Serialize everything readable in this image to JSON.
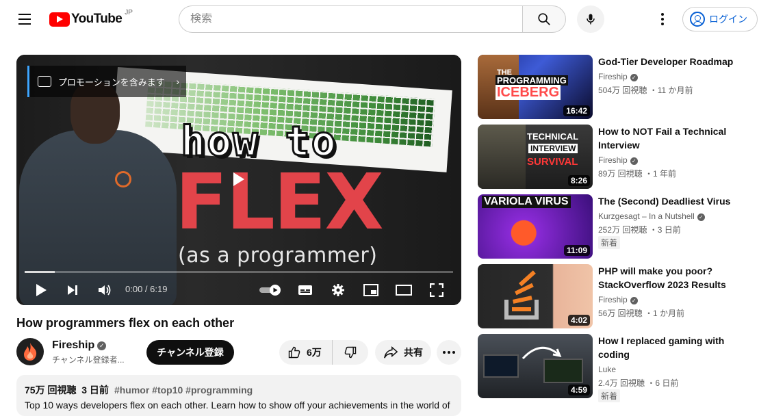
{
  "header": {
    "logo_text": "YouTube",
    "country": "JP",
    "search_placeholder": "検索",
    "login_label": "ログイン"
  },
  "player": {
    "promo_label": "プロモーションを含みます",
    "thumb_line1": "how to",
    "thumb_line2": "FLEX",
    "thumb_line3": "(as a programmer)",
    "time": "0:00 / 6:19",
    "progress": 0.07
  },
  "video": {
    "title": "How programmers flex on each other",
    "channel": "Fireship",
    "subs": "チャンネル登録者...",
    "subscribe_label": "チャンネル登録",
    "likes": "6万",
    "share_label": "共有",
    "views": "75万 回視聴",
    "date": "3 日前",
    "tags": "#humor #top10 #programming",
    "desc": "Top 10 ways developers flex on each other. Learn how to show off your achievements in the world of"
  },
  "recs": [
    {
      "title": "God-Tier Developer Roadmap",
      "channel": "Fireship",
      "verified": true,
      "meta": "504万 回視聴 ・11 か月前",
      "duration": "16:42",
      "badge": "",
      "thumb_text": "THE PROGRAMMING ICEBERG"
    },
    {
      "title": "How to NOT Fail a Technical Interview",
      "channel": "Fireship",
      "verified": true,
      "meta": "89万 回視聴 ・1 年前",
      "duration": "8:26",
      "badge": "",
      "thumb_text": "TECHNICAL INTERVIEW SURVIVAL"
    },
    {
      "title": "The (Second) Deadliest Virus",
      "channel": "Kurzgesagt – In a Nutshell",
      "verified": true,
      "meta": "252万 回視聴 ・3 日前",
      "duration": "11:09",
      "badge": "新着",
      "thumb_text": "VARIOLA VIRUS"
    },
    {
      "title": "PHP will make you poor? StackOverflow 2023 Results",
      "channel": "Fireship",
      "verified": true,
      "meta": "56万 回視聴 ・1 か月前",
      "duration": "4:02",
      "badge": "",
      "thumb_text": ""
    },
    {
      "title": "How I replaced gaming with coding",
      "channel": "Luke",
      "verified": false,
      "meta": "2.4万 回視聴 ・6 日前",
      "duration": "4:59",
      "badge": "新着",
      "thumb_text": ""
    }
  ],
  "colors": {
    "brand_red": "#ff0000",
    "link_blue": "#065fd4",
    "flex_red": "#e2444a"
  }
}
